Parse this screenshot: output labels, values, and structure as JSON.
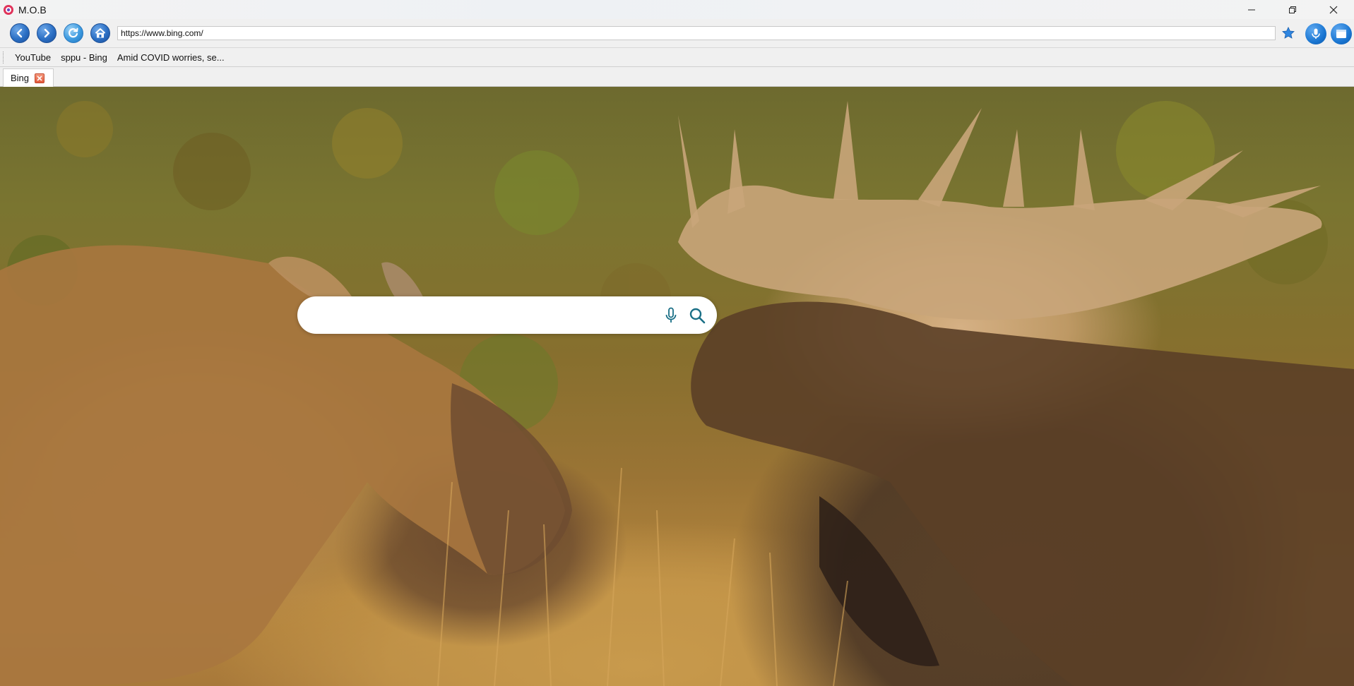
{
  "window": {
    "title": "M.O.B",
    "minimize_glyph": "─",
    "restore_glyph": "❐",
    "close_glyph": "✕"
  },
  "toolbar": {
    "back_icon": "back-arrow-icon",
    "forward_icon": "forward-arrow-icon",
    "refresh_icon": "refresh-icon",
    "home_icon": "home-icon",
    "url_value": "https://www.bing.com/",
    "bookmark_star_icon": "star-icon",
    "voice_icon": "microphone-icon",
    "extension_icon": "window-icon"
  },
  "bookmarks": [
    {
      "label": "YouTube"
    },
    {
      "label": "sppu - Bing"
    },
    {
      "label": "Amid COVID worries, se..."
    }
  ],
  "tabs": [
    {
      "label": "Bing",
      "active": true
    }
  ],
  "page": {
    "search_placeholder": "",
    "search_value": "",
    "search_mic_icon": "microphone-icon",
    "search_button_icon": "search-icon"
  },
  "colors": {
    "nav_blue": "#2b6fc4",
    "accent_blue": "#1a76d2",
    "bing_search_icon": "#1a6f86",
    "tab_close": "#e2583a"
  }
}
